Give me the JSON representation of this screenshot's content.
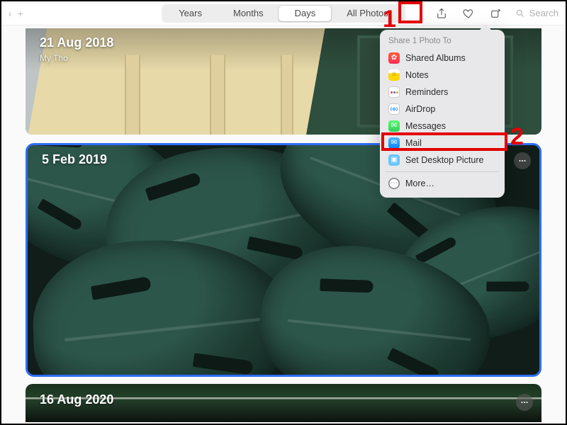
{
  "toolbar": {
    "left_glyph_1": "‹",
    "left_glyph_2": "+",
    "tabs": {
      "years": "Years",
      "months": "Months",
      "days": "Days",
      "all": "All Photos"
    },
    "active_tab": "days",
    "search_placeholder": "Search"
  },
  "tutorial": {
    "step1": "1",
    "step2": "2"
  },
  "share": {
    "header": "Share 1 Photo To",
    "items": [
      {
        "label": "Shared Albums",
        "icon": "shared-albums",
        "color": "#ff2d55"
      },
      {
        "label": "Notes",
        "icon": "notes",
        "color": "#ffcc00"
      },
      {
        "label": "Reminders",
        "icon": "reminders",
        "color": "#ffffff"
      },
      {
        "label": "AirDrop",
        "icon": "airdrop",
        "color": "#ffffff"
      },
      {
        "label": "Messages",
        "icon": "messages",
        "color": "#30d158"
      },
      {
        "label": "Mail",
        "icon": "mail",
        "color": "#1e9bf0"
      },
      {
        "label": "Set Desktop Picture",
        "icon": "desktop",
        "color": "#6ac4ff"
      }
    ],
    "more": "More…"
  },
  "cards": [
    {
      "date": "21 Aug 2018",
      "place": "My Tho"
    },
    {
      "date": "5 Feb 2019"
    },
    {
      "date": "16 Aug 2020"
    }
  ]
}
